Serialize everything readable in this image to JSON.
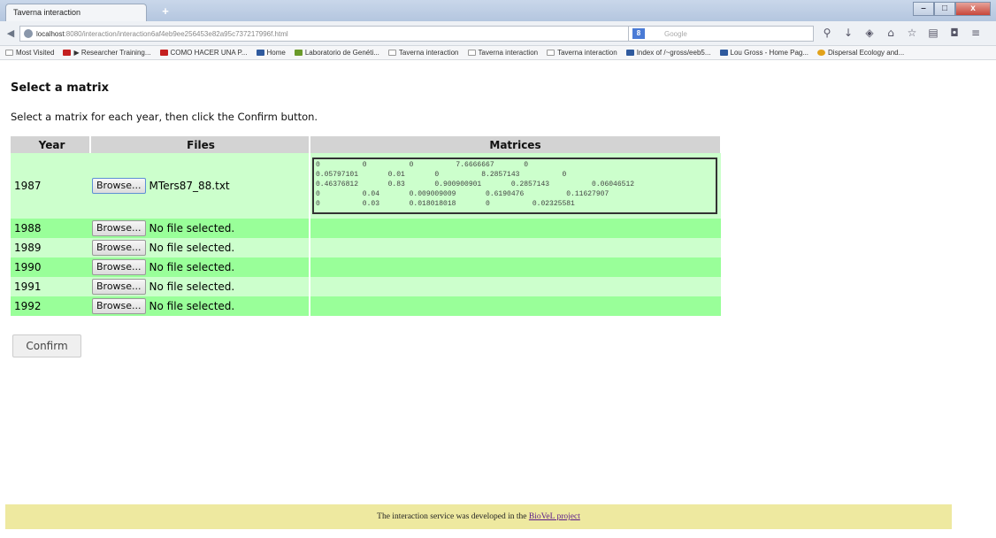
{
  "browser": {
    "tab_title": "Taverna interaction",
    "new_tab": "+",
    "url_host": "localhost",
    "url_rest": ":8080/interaction/interaction6af4eb9ee256453e82a95c737217996f.html",
    "search_engine": "8",
    "search_placeholder": "Google",
    "window_buttons": [
      "–",
      "□",
      "x"
    ],
    "bookmarks": [
      {
        "label": "Most Visited",
        "icon": "folder"
      },
      {
        "label": "▶ Researcher Training...",
        "icon": "red"
      },
      {
        "label": "COMO HACER UNA P...",
        "icon": "red"
      },
      {
        "label": "Home",
        "icon": "blue"
      },
      {
        "label": "Laboratorio de Genéti...",
        "icon": "green"
      },
      {
        "label": "Taverna interaction",
        "icon": "folder"
      },
      {
        "label": "Taverna interaction",
        "icon": "folder"
      },
      {
        "label": "Taverna interaction",
        "icon": "folder"
      },
      {
        "label": "Index of /~gross/eeb5...",
        "icon": "blue"
      },
      {
        "label": "Lou Gross - Home Pag...",
        "icon": "blue"
      },
      {
        "label": "Dispersal Ecology and...",
        "icon": "orange"
      }
    ]
  },
  "page": {
    "title": "Select a matrix",
    "instruction": "Select a matrix for each year, then click the Confirm button.",
    "columns": {
      "year": "Year",
      "files": "Files",
      "matrices": "Matrices"
    },
    "browse_label": "Browse...",
    "rows": [
      {
        "year": "1987",
        "file": "MTers87_88.txt",
        "matrix": "0          0          0          7.6666667       0\n0.05797101       0.01       0          8.2857143          0\n0.46376812       0.83       0.900900901       0.2857143          0.06046512\n0          0.04       0.009009009       0.6190476          0.11627907\n0          0.03       0.018018018       0          0.02325581"
      },
      {
        "year": "1988",
        "file": "No file selected.",
        "matrix": ""
      },
      {
        "year": "1989",
        "file": "No file selected.",
        "matrix": ""
      },
      {
        "year": "1990",
        "file": "No file selected.",
        "matrix": ""
      },
      {
        "year": "1991",
        "file": "No file selected.",
        "matrix": ""
      },
      {
        "year": "1992",
        "file": "No file selected.",
        "matrix": ""
      }
    ],
    "confirm_label": "Confirm",
    "footer_prefix": "The interaction service was developed in the ",
    "footer_link": "BioVeL project"
  },
  "colors": {
    "row_light": "#ccffcc",
    "row_dark": "#99ff99",
    "header": "#d3d3d3",
    "footer": "#eee9a0"
  }
}
